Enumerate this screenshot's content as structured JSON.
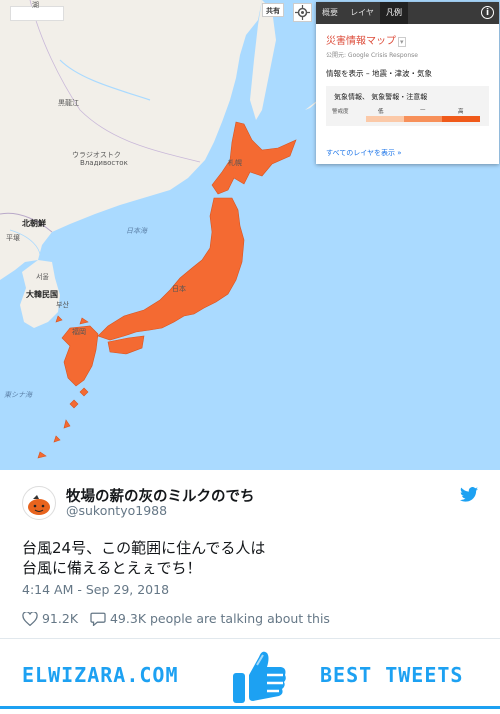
{
  "map": {
    "share_label": "共有",
    "labels": {
      "lake": "湖",
      "heilongjiang": "黒龍江",
      "vladivostok_ja": "ウラジオストク",
      "vladivostok_ru": "Владивосток",
      "north_korea": "北朝鮮",
      "pyongyang": "平壌",
      "seoul": "서울",
      "south_korea": "大韓民国",
      "busan": "부산",
      "sea_of_japan": "日本海",
      "east_china_sea": "東シナ海",
      "sapporo": "札幌",
      "japan": "日本",
      "fukuoka": "福岡"
    }
  },
  "panel": {
    "tabs": [
      "概要",
      "レイヤ",
      "凡例"
    ],
    "active_tab": "凡例",
    "info_icon": "i",
    "title": "災害情報マップ",
    "title_caret": "▾",
    "source": "公開元: Google Crisis Response",
    "display": "情報を表示 – 地震・津波・気象",
    "legend_title": "気象情報、 気象警報・注意報",
    "warning_label": "警戒度",
    "scale_low": "低",
    "scale_mid": "—",
    "scale_high": "高",
    "scale_colors": [
      "#fbc9a8",
      "#f7905a",
      "#f05a1a"
    ],
    "show_all_layers": "すべてのレイヤを表示 »"
  },
  "tweet": {
    "name": "牧場の薪の灰のミルクのでち",
    "handle": "@sukontyo1988",
    "text_line1": "台風24号、この範囲に住んでる人は",
    "text_line2": "台風に備えるとえぇでち！",
    "timestamp": "4:14 AM - Sep 29, 2018",
    "likes": "91.2K",
    "talking": "49.3K people are talking about this"
  },
  "footer": {
    "left_brand": "ELWIZARA.COM",
    "right_brand": "BEST TWEETS",
    "brand_color": "#1da1f2"
  },
  "colors": {
    "highlight": "#f46a32",
    "sea": "#aadaff",
    "land": "#f2efe9",
    "twitter_blue": "#1da1f2"
  }
}
